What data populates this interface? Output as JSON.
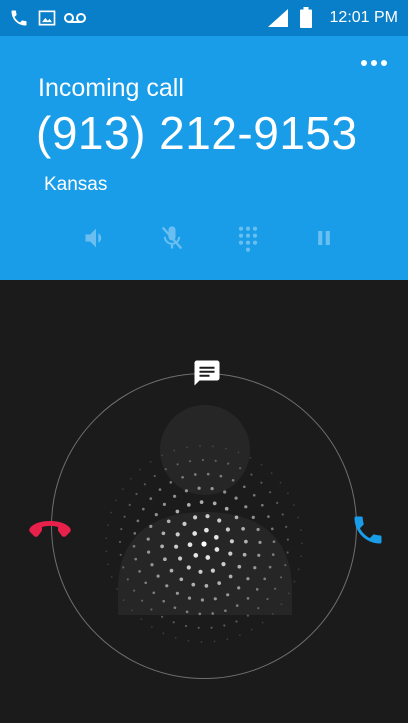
{
  "status_bar": {
    "time": "12:01 PM",
    "icons": [
      "phone-icon",
      "image-icon",
      "voicemail-icon",
      "signal-icon",
      "battery-icon"
    ]
  },
  "call": {
    "status_label": "Incoming call",
    "number": "(913) 212-9153",
    "location": "Kansas"
  },
  "controls": [
    "speaker-icon",
    "mute-mic-icon",
    "dialpad-icon",
    "pause-icon"
  ],
  "actions": [
    "message-icon",
    "decline-call-icon",
    "answer-call-icon"
  ],
  "colors": {
    "status_bar": "#0a7fc9",
    "header": "#1a9de9",
    "background": "#1b1b1b",
    "decline": "#e8214b",
    "answer": "#1a9de9"
  }
}
